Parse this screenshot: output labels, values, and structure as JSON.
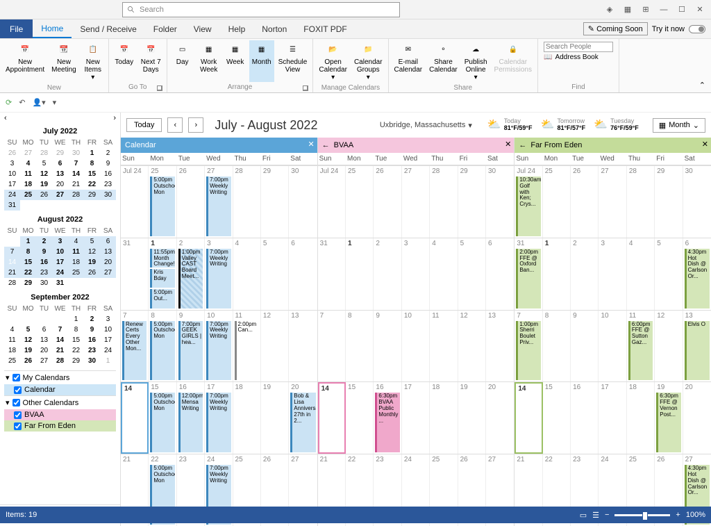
{
  "search_placeholder": "Search",
  "tabs": {
    "file": "File",
    "home": "Home",
    "sendrecv": "Send / Receive",
    "folder": "Folder",
    "view": "View",
    "help": "Help",
    "norton": "Norton",
    "foxit": "FOXIT PDF"
  },
  "coming_soon": "Coming Soon",
  "try_it": "Try it now",
  "off": "Off",
  "ribbon": {
    "new_appt": "New\nAppointment",
    "new_meet": "New\nMeeting",
    "new_items": "New\nItems",
    "new_label": "New",
    "today": "Today",
    "next7": "Next 7\nDays",
    "goto_label": "Go To",
    "day": "Day",
    "wweek": "Work\nWeek",
    "week": "Week",
    "month": "Month",
    "sched": "Schedule\nView",
    "arrange": "Arrange",
    "opencal": "Open\nCalendar",
    "calgroups": "Calendar\nGroups",
    "manage": "Manage Calendars",
    "email": "E-mail\nCalendar",
    "sharecal": "Share\nCalendar",
    "publish": "Publish\nOnline",
    "perms": "Calendar\nPermissions",
    "share": "Share",
    "search_ppl": "Search People",
    "addrbook": "Address Book",
    "find": "Find"
  },
  "minicals": [
    {
      "title": "July 2022",
      "hdrs": [
        "SU",
        "MO",
        "TU",
        "WE",
        "TH",
        "FR",
        "SA"
      ],
      "days": [
        [
          "26",
          "g"
        ],
        [
          "27",
          "g"
        ],
        [
          "28",
          "g"
        ],
        [
          "29",
          "g"
        ],
        [
          "30",
          "g"
        ],
        [
          "1",
          "b"
        ],
        [
          "2",
          ""
        ],
        [
          "3",
          ""
        ],
        [
          "4",
          "b"
        ],
        [
          "5",
          ""
        ],
        [
          "6",
          "b"
        ],
        [
          "7",
          "b"
        ],
        [
          "8",
          "b"
        ],
        [
          "9",
          ""
        ],
        [
          "10",
          ""
        ],
        [
          "11",
          "b"
        ],
        [
          "12",
          "b"
        ],
        [
          "13",
          "b"
        ],
        [
          "14",
          "b"
        ],
        [
          "15",
          "b"
        ],
        [
          "16",
          ""
        ],
        [
          "17",
          ""
        ],
        [
          "18",
          "b"
        ],
        [
          "19",
          "b"
        ],
        [
          "20",
          ""
        ],
        [
          "21",
          ""
        ],
        [
          "22",
          "b"
        ],
        [
          "23",
          ""
        ],
        [
          "24",
          "r"
        ],
        [
          "25",
          "rb"
        ],
        [
          "26",
          "r"
        ],
        [
          "27",
          "rb"
        ],
        [
          "28",
          "r"
        ],
        [
          "29",
          "r"
        ],
        [
          "30",
          "r"
        ],
        [
          "31",
          "r"
        ],
        [
          "",
          "e"
        ],
        [
          "",
          "e"
        ],
        [
          "",
          "e"
        ],
        [
          "",
          "e"
        ],
        [
          "",
          "e"
        ],
        [
          "",
          "e"
        ]
      ]
    },
    {
      "title": "August 2022",
      "hdrs": [
        "SU",
        "MO",
        "TU",
        "WE",
        "TH",
        "FR",
        "SA"
      ],
      "days": [
        [
          "",
          "e"
        ],
        [
          "1",
          "rb"
        ],
        [
          "2",
          "rb"
        ],
        [
          "3",
          "rb"
        ],
        [
          "4",
          "r"
        ],
        [
          "5",
          "r"
        ],
        [
          "6",
          "r"
        ],
        [
          "7",
          "r"
        ],
        [
          "8",
          "rb"
        ],
        [
          "9",
          "rb"
        ],
        [
          "10",
          "rb"
        ],
        [
          "11",
          "rb"
        ],
        [
          "12",
          "r"
        ],
        [
          "13",
          "r"
        ],
        [
          "14",
          "t"
        ],
        [
          "15",
          "rb"
        ],
        [
          "16",
          "rb"
        ],
        [
          "17",
          "rb"
        ],
        [
          "18",
          "r"
        ],
        [
          "19",
          "rb"
        ],
        [
          "20",
          "r"
        ],
        [
          "21",
          "r"
        ],
        [
          "22",
          "rb"
        ],
        [
          "23",
          "r"
        ],
        [
          "24",
          "rb"
        ],
        [
          "25",
          "r"
        ],
        [
          "26",
          "r"
        ],
        [
          "27",
          "r"
        ],
        [
          "28",
          ""
        ],
        [
          "29",
          "b"
        ],
        [
          "30",
          ""
        ],
        [
          "31",
          "b"
        ],
        [
          "",
          "e"
        ],
        [
          "",
          "e"
        ],
        [
          "",
          "e"
        ]
      ]
    },
    {
      "title": "September 2022",
      "hdrs": [
        "SU",
        "MO",
        "TU",
        "WE",
        "TH",
        "FR",
        "SA"
      ],
      "days": [
        [
          "",
          "e"
        ],
        [
          "",
          "e"
        ],
        [
          "",
          "e"
        ],
        [
          "",
          "e"
        ],
        [
          "1",
          ""
        ],
        [
          "2",
          "b"
        ],
        [
          "3",
          ""
        ],
        [
          "4",
          ""
        ],
        [
          "5",
          "b"
        ],
        [
          "6",
          ""
        ],
        [
          "7",
          "b"
        ],
        [
          "8",
          ""
        ],
        [
          "9",
          "b"
        ],
        [
          "10",
          ""
        ],
        [
          "11",
          ""
        ],
        [
          "12",
          "b"
        ],
        [
          "13",
          ""
        ],
        [
          "14",
          "b"
        ],
        [
          "15",
          ""
        ],
        [
          "16",
          "b"
        ],
        [
          "17",
          ""
        ],
        [
          "18",
          ""
        ],
        [
          "19",
          "b"
        ],
        [
          "20",
          ""
        ],
        [
          "21",
          "b"
        ],
        [
          "22",
          ""
        ],
        [
          "23",
          "b"
        ],
        [
          "24",
          ""
        ],
        [
          "25",
          ""
        ],
        [
          "26",
          "b"
        ],
        [
          "27",
          ""
        ],
        [
          "28",
          "b"
        ],
        [
          "29",
          ""
        ],
        [
          "30",
          "b"
        ],
        [
          "1",
          "g"
        ]
      ]
    }
  ],
  "caltree": {
    "mycals": "My Calendars",
    "calendar": "Calendar",
    "othercals": "Other Calendars",
    "bvaa": "BVAA",
    "ffe": "Far From Eden"
  },
  "today_btn": "Today",
  "range_title": "July - August 2022",
  "location": "Uxbridge, Massachusetts",
  "weather": [
    {
      "label": "Today",
      "temp": "81°F/59°F"
    },
    {
      "label": "Tomorrow",
      "temp": "81°F/57°F"
    },
    {
      "label": "Tuesday",
      "temp": "76°F/59°F"
    }
  ],
  "month_btn": "Month",
  "columns": [
    {
      "name": "Calendar",
      "color": "blue",
      "dayhdrs": [
        "Sun",
        "Mon",
        "Tue",
        "Wed",
        "Thu",
        "Fri",
        "Sat"
      ],
      "weeks": [
        {
          "nums": [
            "Jul 24",
            "25",
            "26",
            "27",
            "28",
            "29",
            "30"
          ],
          "events": [
            [],
            [
              {
                "t": "5:00pm Outschool Mon",
                "c": "blue"
              }
            ],
            [],
            [
              {
                "t": "7:00pm Weekly Writing",
                "c": "blue"
              }
            ],
            [],
            [],
            []
          ]
        },
        {
          "nums": [
            "31",
            "1",
            "2",
            "3",
            "4",
            "5",
            "6"
          ],
          "bold": [
            false,
            true,
            false,
            false,
            false,
            false,
            false
          ],
          "events": [
            [],
            [
              {
                "t": "11:55pm Month Change!",
                "c": "blue"
              },
              {
                "t": "Kris Bday",
                "c": "blue"
              },
              {
                "t": "5:00pm Out...",
                "c": "blue"
              }
            ],
            [
              {
                "t": "1:00pm Valley CAST Board Meet...",
                "c": "hatch"
              }
            ],
            [
              {
                "t": "7:00pm Weekly Writing",
                "c": "blue"
              }
            ],
            [],
            [],
            []
          ]
        },
        {
          "nums": [
            "7",
            "8",
            "9",
            "10",
            "11",
            "12",
            "13"
          ],
          "events": [
            [
              {
                "t": "Renew Certs Every Other Mon...",
                "c": "blue"
              }
            ],
            [
              {
                "t": "5:00pm Outschool Mon",
                "c": "blue"
              }
            ],
            [
              {
                "t": "7:00pm GEEK GIRLS | hea...",
                "c": "blue"
              }
            ],
            [
              {
                "t": "7:00pm Weekly Writing",
                "c": "blue"
              }
            ],
            [
              {
                "t": "2:00pm Can...",
                "c": "white"
              }
            ],
            [],
            []
          ]
        },
        {
          "nums": [
            "14",
            "15",
            "16",
            "17",
            "18",
            "19",
            "20"
          ],
          "bold": [
            true,
            false,
            false,
            false,
            false,
            false,
            false
          ],
          "today": 0,
          "events": [
            [],
            [
              {
                "t": "5:00pm Outschool Mon",
                "c": "blue"
              }
            ],
            [
              {
                "t": "12:00pm Mensa Writing",
                "c": "blue"
              }
            ],
            [
              {
                "t": "7:00pm Weekly Writing",
                "c": "blue"
              }
            ],
            [],
            [],
            [
              {
                "t": "Bob & Lisa Anniversary 27th in 2...",
                "c": "blue"
              }
            ]
          ]
        },
        {
          "nums": [
            "21",
            "22",
            "23",
            "24",
            "25",
            "26",
            "27"
          ],
          "events": [
            [],
            [
              {
                "t": "5:00pm Outschool Mon",
                "c": "blue"
              }
            ],
            [],
            [
              {
                "t": "7:00pm Weekly Writing",
                "c": "blue"
              }
            ],
            [],
            [],
            []
          ]
        }
      ]
    },
    {
      "name": "BVAA",
      "color": "pink",
      "back": true,
      "dayhdrs": [
        "Sun",
        "Mon",
        "Tue",
        "Wed",
        "Thu",
        "Fri",
        "Sat"
      ],
      "weeks": [
        {
          "nums": [
            "Jul 24",
            "25",
            "26",
            "27",
            "28",
            "29",
            "30"
          ],
          "events": [
            [],
            [],
            [],
            [],
            [],
            [],
            []
          ]
        },
        {
          "nums": [
            "31",
            "1",
            "2",
            "3",
            "4",
            "5",
            "6"
          ],
          "bold": [
            false,
            true,
            false,
            false,
            false,
            false,
            false
          ],
          "events": [
            [],
            [],
            [],
            [],
            [],
            [],
            []
          ]
        },
        {
          "nums": [
            "7",
            "8",
            "9",
            "10",
            "11",
            "12",
            "13"
          ],
          "events": [
            [],
            [],
            [],
            [],
            [],
            [],
            []
          ]
        },
        {
          "nums": [
            "14",
            "15",
            "16",
            "17",
            "18",
            "19",
            "20"
          ],
          "bold": [
            true,
            false,
            false,
            false,
            false,
            false,
            false
          ],
          "today": 0,
          "events": [
            [],
            [],
            [
              {
                "t": "6:30pm BVAA Public Monthly ...",
                "c": "pink"
              }
            ],
            [],
            [],
            [],
            []
          ]
        },
        {
          "nums": [
            "21",
            "22",
            "23",
            "24",
            "25",
            "26",
            "27"
          ],
          "events": [
            [],
            [],
            [],
            [],
            [],
            [],
            []
          ]
        }
      ]
    },
    {
      "name": "Far From Eden",
      "color": "green",
      "back": true,
      "dayhdrs": [
        "Sun",
        "Mon",
        "Tue",
        "Wed",
        "Thu",
        "Fri",
        "Sat"
      ],
      "weeks": [
        {
          "nums": [
            "Jul 24",
            "25",
            "26",
            "27",
            "28",
            "29",
            "30"
          ],
          "events": [
            [
              {
                "t": "10:30am Golf with Ken; Crys...",
                "c": "green"
              }
            ],
            [],
            [],
            [],
            [],
            [],
            []
          ]
        },
        {
          "nums": [
            "31",
            "1",
            "2",
            "3",
            "4",
            "5",
            "6"
          ],
          "bold": [
            false,
            true,
            false,
            false,
            false,
            false,
            false
          ],
          "events": [
            [
              {
                "t": "2:00pm FFE @ Oxford Ban...",
                "c": "green"
              }
            ],
            [],
            [],
            [],
            [],
            [],
            [
              {
                "t": "4:30pm Hot Dish @ Carlson Or...",
                "c": "green"
              }
            ]
          ]
        },
        {
          "nums": [
            "7",
            "8",
            "9",
            "10",
            "11",
            "12",
            "13"
          ],
          "events": [
            [
              {
                "t": "1:00pm Sherri Boulet Priv...",
                "c": "green"
              }
            ],
            [],
            [],
            [],
            [
              {
                "t": "6:00pm FFE @ Sutton Gaz...",
                "c": "green"
              }
            ],
            [],
            [
              {
                "t": "Elvis O",
                "c": "green"
              }
            ]
          ]
        },
        {
          "nums": [
            "14",
            "15",
            "16",
            "17",
            "18",
            "19",
            "20"
          ],
          "bold": [
            true,
            false,
            false,
            false,
            false,
            false,
            false
          ],
          "today": 0,
          "events": [
            [],
            [],
            [],
            [],
            [],
            [
              {
                "t": "6:30pm FFE @ Vernon Post...",
                "c": "green"
              }
            ],
            []
          ]
        },
        {
          "nums": [
            "21",
            "22",
            "23",
            "24",
            "25",
            "26",
            "27"
          ],
          "events": [
            [],
            [],
            [],
            [],
            [],
            [],
            [
              {
                "t": "4:30pm Hot Dish @ Carlson Or...",
                "c": "green"
              }
            ]
          ]
        }
      ]
    }
  ],
  "status": {
    "items": "Items: 19",
    "zoom": "100%"
  }
}
